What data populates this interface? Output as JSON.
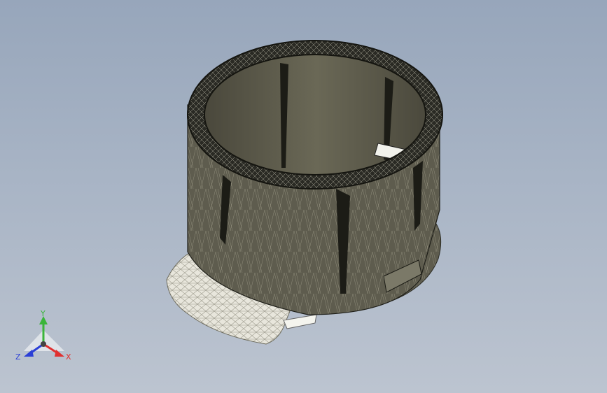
{
  "triad": {
    "y_label": "Y",
    "x_label": "X",
    "z_label": "Z",
    "y_color": "#3ab53a",
    "x_color": "#e03030",
    "z_color": "#2b3fd6"
  },
  "model": {
    "icon": "cad-ring-mesh-model",
    "body_color": "#5c5a4c",
    "rim_color": "#1a1a16",
    "mesh_color": "#c8c5b4",
    "wing_color": "#ecebe2"
  }
}
